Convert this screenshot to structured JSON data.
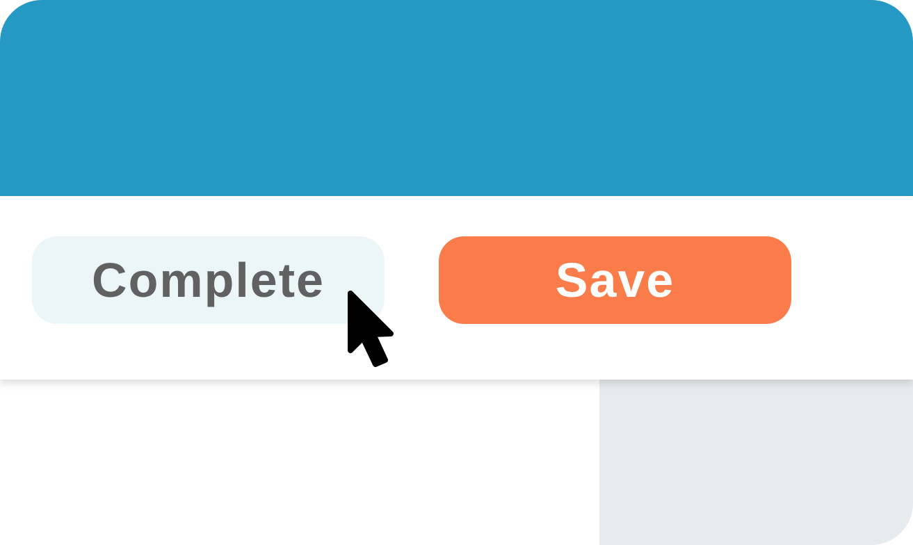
{
  "colors": {
    "header": "#2698c4",
    "complete_bg": "#ecf6f9",
    "complete_text": "#616161",
    "save_bg": "#f97c4a",
    "save_text": "#ffffff",
    "side_panel": "#e6ebed"
  },
  "actions": {
    "complete_label": "Complete",
    "save_label": "Save"
  },
  "icons": {
    "pointer": "mouse-pointer-icon"
  }
}
